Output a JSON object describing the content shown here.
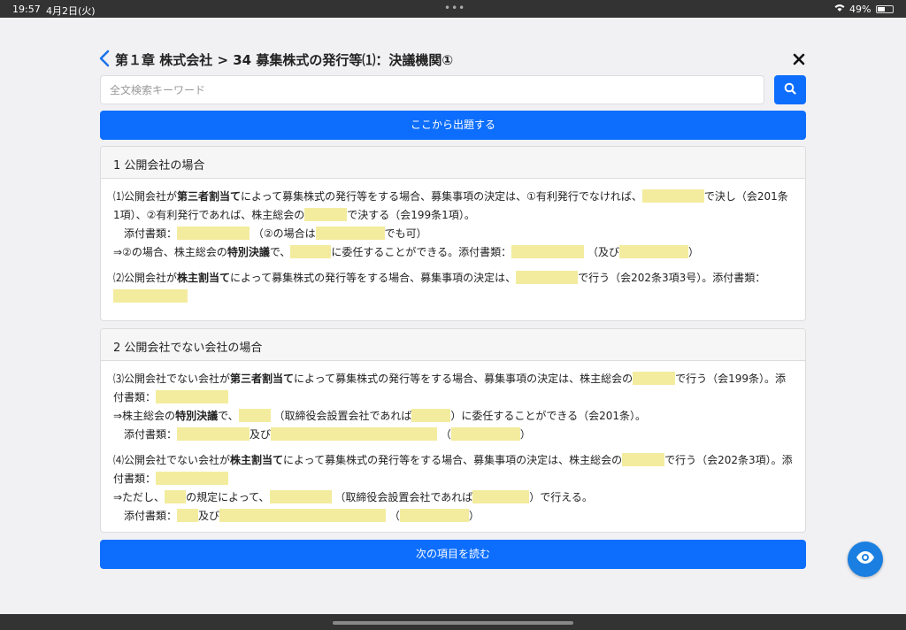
{
  "status": {
    "time": "19:57",
    "date": "4月2日(火)",
    "battery": "49%"
  },
  "header": {
    "title": "第１章 株式会社 > 34 募集株式の発行等⑴：決議機関①"
  },
  "search": {
    "placeholder": "全文検索キーワード",
    "value": ""
  },
  "buttons": {
    "quiz": "ここから出題する",
    "next": "次の項目を読む"
  },
  "section1": {
    "title": "1 公開会社の場合",
    "p1_a": "⑴公開会社が",
    "p1_bold": "第三者割当て",
    "p1_b": "によって募集株式の発行等をする場合、募集事項の決定は、①有利発行でなければ、",
    "p1_c": "で決し（会201条1項）、②有利発行であれば、株主総会の",
    "p1_d": "で決する（会199条1項）。",
    "attach_label": "添付書類：",
    "p1_e": "（②の場合は",
    "p1_f": "でも可）",
    "p1_g": "⇒②の場合、株主総会の",
    "p1_g_bold": "特別決議",
    "p1_h": "で、",
    "p1_i": "に委任することができる。添付書類：",
    "p1_j": "（及び",
    "p1_k": "）",
    "p2_a": "⑵公開会社が",
    "p2_bold": "株主割当て",
    "p2_b": "によって募集株式の発行等をする場合、募集事項の決定は、",
    "p2_c": "で行う（会202条3項3号）。添付書類："
  },
  "section2": {
    "title": "2 公開会社でない会社の場合",
    "p3_a": "⑶公開会社でない会社が",
    "p3_bold": "第三者割当て",
    "p3_b": "によって募集株式の発行等をする場合、募集事項の決定は、株主総会の",
    "p3_c": "で行う（会199条）。添付書類：",
    "p3_d": "⇒株主総会の",
    "p3_d_bold": "特別決議",
    "p3_e": "で、",
    "p3_f": "（取締役会設置会社であれば",
    "p3_g": "）に委任することができる（会201条）。",
    "attach_label": "添付書類：",
    "and": "及び",
    "paren_open": "（",
    "paren_close": "）",
    "p4_a": "⑷公開会社でない会社が",
    "p4_bold": "株主割当て",
    "p4_b": "によって募集株式の発行等をする場合、募集事項の決定は、株主総会の",
    "p4_c": "で行う（会202条3項）。添付書類：",
    "p4_d": "⇒ただし、",
    "p4_e": "の規定によって、",
    "p4_f": "（取締役会設置会社であれば",
    "p4_g": "）で行える。"
  },
  "colors": {
    "accent": "#0d6efd",
    "blank": "#f3ec9e"
  },
  "icons": [
    "chevron-left-icon",
    "close-icon",
    "search-icon",
    "eye-icon"
  ]
}
